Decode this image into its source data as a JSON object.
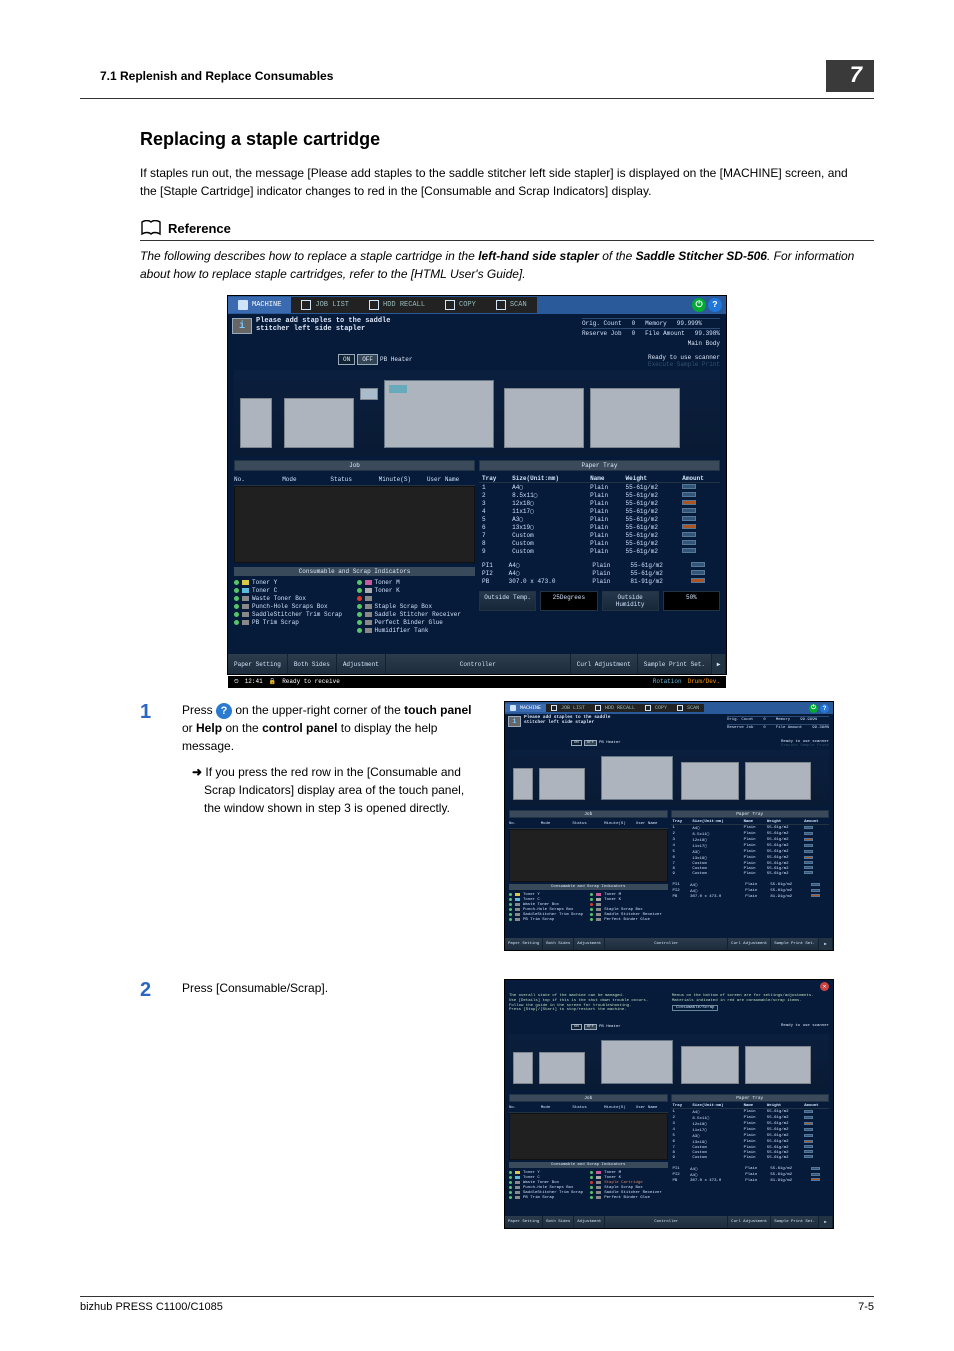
{
  "header": {
    "section": "7.1    Replenish and Replace Consumables",
    "chapter": "7"
  },
  "heading": "Replacing a staple cartridge",
  "intro": "If staples run out, the message [Please add staples to the saddle stitcher left side stapler] is displayed on the [MACHINE] screen, and the [Staple Cartridge] indicator changes to red in the [Consumable and Scrap Indicators] display.",
  "reference": {
    "label": "Reference",
    "text_pre": "The following describes how to replace a staple cartridge in the ",
    "bold1": "left-hand side stapler",
    "text_mid": " of the ",
    "bold2": "Saddle Stitcher SD-506",
    "text_post": ". For information about how to replace staple cartridges, refer to the [HTML User's Guide]."
  },
  "screen": {
    "tabs": {
      "machine": "MACHINE",
      "joblist": "JOB LIST",
      "hddrecall": "HDD RECALL",
      "copy": "COPY",
      "scan": "SCAN"
    },
    "help_icon": "?",
    "eco_icon": "⏻",
    "message_l1": "Please add staples to the saddle",
    "message_l2": "stitcher left side stapler",
    "main_body_label": "Main Body",
    "stats": {
      "orig_count_label": "Orig. Count",
      "orig_count_value": "0",
      "memory_label": "Memory",
      "memory_value": "99.999%",
      "reserve_label": "Reserve Job",
      "reserve_value": "0",
      "file_amount_label": "File Amount",
      "file_amount_value": "99.398%"
    },
    "heater": {
      "on": "ON",
      "off": "OFF",
      "label": "PB Heater"
    },
    "ready": "Ready to use scanner",
    "execute_sample": "Execute Sample Print",
    "job_section": "Job",
    "tray_section": "Paper Tray",
    "job_cols": {
      "no": "No.",
      "mode": "Mode",
      "status": "Status",
      "minutes": "Minute(S)",
      "user": "User Name"
    },
    "consumable_hdr": "Consumable and Scrap Indicators",
    "consumables_left": [
      "Toner Y",
      "Toner C",
      "Waste Toner Box",
      "Punch-Hole Scraps Box",
      "SaddleStitcher Trim Scrap",
      "PB Trim Scrap"
    ],
    "consumables_right": [
      "Toner M",
      "Toner K",
      "",
      "Staple Scrap Box",
      "Saddle Stitcher Receiver",
      "Perfect Binder Glue",
      "Humidifier Tank"
    ],
    "tray_cols": {
      "tray": "Tray",
      "size": "Size(Unit:mm)",
      "name": "Name",
      "weight": "Weight",
      "amount": "Amount"
    },
    "trays": [
      {
        "tray": "1",
        "size": "A4▢",
        "name": "Plain",
        "weight": "55-61g/m2"
      },
      {
        "tray": "2",
        "size": "8.5x11▢",
        "name": "Plain",
        "weight": "55-61g/m2"
      },
      {
        "tray": "3",
        "size": "12x18▢",
        "name": "Plain",
        "weight": "55-61g/m2"
      },
      {
        "tray": "4",
        "size": "11x17▢",
        "name": "Plain",
        "weight": "55-61g/m2"
      },
      {
        "tray": "5",
        "size": "A3▢",
        "name": "Plain",
        "weight": "55-61g/m2"
      },
      {
        "tray": "6",
        "size": "13x19▢",
        "name": "Plain",
        "weight": "55-61g/m2"
      },
      {
        "tray": "7",
        "size": "Custom",
        "name": "Plain",
        "weight": "55-61g/m2"
      },
      {
        "tray": "8",
        "size": "Custom",
        "name": "Plain",
        "weight": "55-61g/m2"
      },
      {
        "tray": "9",
        "size": "Custom",
        "name": "Plain",
        "weight": "55-61g/m2"
      }
    ],
    "pi_trays": [
      {
        "tray": "PI1",
        "size": "A4▢",
        "name": "Plain",
        "weight": "55-61g/m2"
      },
      {
        "tray": "PI2",
        "size": "A4▢",
        "name": "Plain",
        "weight": "55-61g/m2"
      },
      {
        "tray": "PB",
        "size": "307.0 x 473.0",
        "name": "Plain",
        "weight": "81-91g/m2"
      }
    ],
    "outside_temp_label": "Outside Temp.",
    "outside_temp_val": "25Degrees",
    "outside_humid_label": "Outside Humidity",
    "outside_humid_val": "50%",
    "bottom": {
      "paper_setting": "Paper Setting",
      "both_sides": "Both Sides",
      "adjustment": "Adjustment",
      "controller": "Controller",
      "curl": "Curl Adjustment",
      "sample": "Sample Print Set.",
      "arrow": "▶"
    },
    "status_time": "12:41",
    "status_ready": "Ready to receive",
    "status_rotation": "Rotation",
    "status_drum": "Drum/Dev."
  },
  "step1": {
    "num": "1",
    "text_before": "Press ",
    "text_after1": " on the upper-right corner of the ",
    "b1": "touch panel",
    "or": " or ",
    "b2": "Help",
    "on_the": " on the ",
    "b3": "control panel",
    "text_end": " to display the help message.",
    "sub_arrow": "➜",
    "sub": "If you press the red row in the [Consumable and Scrap Indicators] display area of the touch panel, the window shown in step 3 is opened directly."
  },
  "step2": {
    "num": "2",
    "text": "Press [Consumable/Scrap].",
    "top_msg_l1": "The overall state of the machine can be managed.",
    "top_msg_l2": "Use [Details] top if this is the shut down trouble occurs.",
    "top_msg_l3": "Follow the guide in the screen for troubleshooting.",
    "top_msg_l4": "Press [Stop]/[Start] to stop/restart the machine.",
    "top_msg_r1": "Menus on the bottom of screen are for settings/adjustments.",
    "top_msg_r2": "Materials indicated in red are consumable/scrap items.",
    "btn_consumable": "Consumable/Scrap",
    "highlight_row": "Staple Cartridge"
  },
  "footer": {
    "product": "bizhub PRESS C1100/C1085",
    "page": "7-5"
  }
}
